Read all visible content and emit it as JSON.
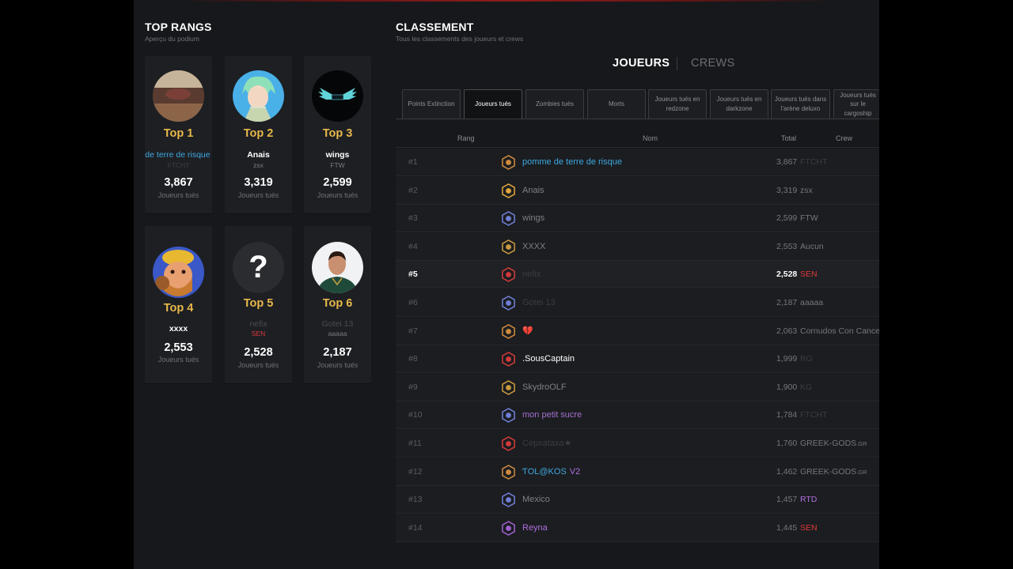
{
  "top_ranks": {
    "title": "TOP RANGS",
    "subtitle": "Aperçu du podium",
    "cards": [
      {
        "rank": "Top 1",
        "name": "pomme de terre de risque",
        "crew": "FTCHT",
        "score": "3,867",
        "unit": "Joueurs tués",
        "name_color": "#3fa8e0",
        "crew_color": "#3c3e42"
      },
      {
        "rank": "Top 2",
        "name": "Anais",
        "crew": "zsx",
        "score": "3,319",
        "unit": "Joueurs tués",
        "name_color": "#ffffff",
        "crew_color": "#7a7d83"
      },
      {
        "rank": "Top 3",
        "name": "wings",
        "crew": "FTW",
        "score": "2,599",
        "unit": "Joueurs tués",
        "name_color": "#ffffff",
        "crew_color": "#7a7d83"
      },
      {
        "rank": "Top 4",
        "name": "xxxx",
        "crew": "",
        "score": "2,553",
        "unit": "Joueurs tués",
        "name_color": "#ffffff",
        "crew_color": "#7a7d83"
      },
      {
        "rank": "Top 5",
        "name": "nefix",
        "crew": "SEN",
        "score": "2,528",
        "unit": "Joueurs tués",
        "name_color": "#4a4c50",
        "crew_color": "#e0383a"
      },
      {
        "rank": "Top 6",
        "name": "Gotei 13",
        "crew": "aaaaa",
        "score": "2,187",
        "unit": "Joueurs tués",
        "name_color": "#4a4c50",
        "crew_color": "#7a7d83"
      }
    ]
  },
  "ranking": {
    "title": "CLASSEMENT",
    "subtitle": "Tous les classements des joueurs et crews",
    "segments": {
      "players": "JOUEURS",
      "crews": "CREWS"
    },
    "tabs": [
      {
        "label": "Points Extinction"
      },
      {
        "label": "Joueurs tués"
      },
      {
        "label": "Zombies tués"
      },
      {
        "label": "Morts"
      },
      {
        "label": "Joueurs tués en redzone"
      },
      {
        "label": "Joueurs tués en darkzone"
      },
      {
        "label": "Joueurs tués dans l'arène deluxo"
      },
      {
        "label": "Joueurs tués sur le cargoship"
      }
    ],
    "columns": {
      "rank": "Rang",
      "name": "Nom",
      "total": "Total",
      "crew": "Crew"
    },
    "rows": [
      {
        "rank": "#1",
        "name": "pomme de terre de risque",
        "name_color": "#3fa8e0",
        "total": "3,867",
        "crew": "FTCHT",
        "crew_suffix": "",
        "crew_color": "#3a3c40",
        "icon": "bronze-flame-badge-icon",
        "icon_color": "#d08a3e"
      },
      {
        "rank": "#2",
        "name": "Anais",
        "name_color": "#7d8087",
        "total": "3,319",
        "crew": "zsx",
        "crew_suffix": "",
        "crew_color": "#74777d",
        "icon": "gold-skull-badge-icon",
        "icon_color": "#e3a53c"
      },
      {
        "rank": "#3",
        "name": "wings",
        "name_color": "#7d8087",
        "total": "2,599",
        "crew": "FTW",
        "crew_suffix": "",
        "crew_color": "#74777d",
        "icon": "blue-hex-badge-icon",
        "icon_color": "#6f7fd6"
      },
      {
        "rank": "#4",
        "name": "XXXX",
        "name_color": "#7d8087",
        "total": "2,553",
        "crew": "Aucun",
        "crew_suffix": "",
        "crew_color": "#74777d",
        "icon": "gold-sword-badge-icon",
        "icon_color": "#c99a40"
      },
      {
        "rank": "#5",
        "name": "nefix",
        "name_color": "#3a3c40",
        "total": "2,528",
        "crew": "SEN",
        "crew_suffix": "",
        "crew_color": "#e0383a",
        "icon": "red-skull-badge-icon",
        "icon_color": "#d23a3a"
      },
      {
        "rank": "#6",
        "name": "Gotei 13",
        "name_color": "#3a3c40",
        "total": "2,187",
        "crew": "aaaaa",
        "crew_suffix": "",
        "crew_color": "#74777d",
        "icon": "blue-hex-badge-icon",
        "icon_color": "#6f7fd6"
      },
      {
        "rank": "#7",
        "name": "💔",
        "name_color": "#e0383a",
        "total": "2,063",
        "crew": "Cornudos Con Cancer",
        "crew_suffix": "",
        "crew_color": "#74777d",
        "icon": "bronze-flame-badge-icon",
        "icon_color": "#d08a3e"
      },
      {
        "rank": "#8",
        "name": ".SousCaptain",
        "name_color": "#ffffff",
        "total": "1,999",
        "crew": "RG",
        "crew_suffix": "",
        "crew_color": "#3a3c40",
        "icon": "red-cross-badge-icon",
        "icon_color": "#d23a3a"
      },
      {
        "rank": "#9",
        "name": "SkydroOLF",
        "name_color": "#7d8087",
        "total": "1,900",
        "crew": "KG",
        "crew_suffix": "",
        "crew_color": "#3a3c40",
        "icon": "gold-eagle-badge-icon",
        "icon_color": "#c99a40"
      },
      {
        "rank": "#10",
        "name": "mon petit sucre",
        "name_color": "#a76fd0",
        "total": "1,784",
        "crew": "FTCHT",
        "crew_suffix": "",
        "crew_color": "#3a3c40",
        "icon": "blue-hex-badge-icon",
        "icon_color": "#6f7fd6"
      },
      {
        "rank": "#11",
        "name": "Cepxataxa★",
        "name_color": "#3a3c40",
        "total": "1,760",
        "crew": "GREEK-GODS",
        "crew_suffix": ".GR",
        "crew_color": "#74777d",
        "icon": "red-cross-badge-icon",
        "icon_color": "#d23a3a"
      },
      {
        "rank": "#12",
        "name": "ƬOL@KOS",
        "name_suffix": "V2",
        "name_color": "#3fa8e0",
        "total": "1,462",
        "crew": "GREEK-GODS",
        "crew_suffix": ".GR",
        "crew_color": "#74777d",
        "icon": "bronze-flame-badge-icon",
        "icon_color": "#d08a3e"
      },
      {
        "rank": "#13",
        "name": "Mexico",
        "name_color": "#7d8087",
        "total": "1,457",
        "crew": "RTD",
        "crew_suffix": "",
        "crew_color": "#b06fe0",
        "icon": "blue-hex-badge-icon",
        "icon_color": "#6f7fd6"
      },
      {
        "rank": "#14",
        "name": "Reyna",
        "name_color": "#b06fe0",
        "total": "1,445",
        "crew": "SEN",
        "crew_suffix": "",
        "crew_color": "#e0383a",
        "icon": "purple-skull-badge-icon",
        "icon_color": "#a060d0"
      }
    ]
  },
  "colors": {
    "accent_gold": "#e8b84a",
    "bg": "#17181b",
    "card": "#1d1f23"
  }
}
